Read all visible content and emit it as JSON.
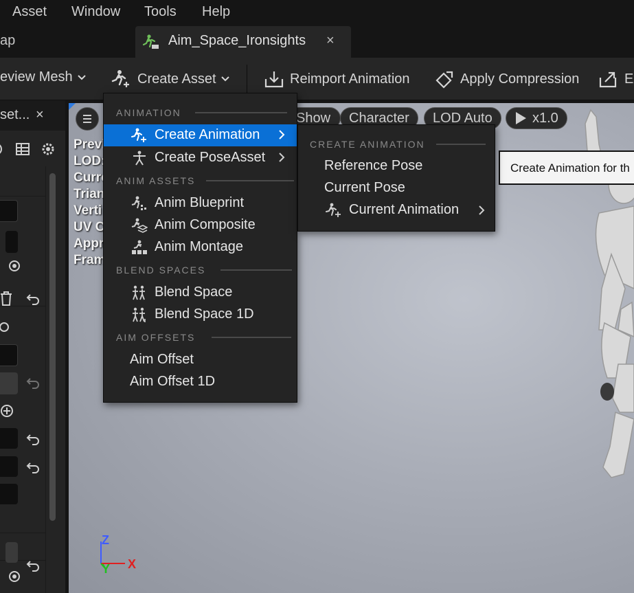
{
  "menubar": {
    "items": [
      "Asset",
      "Window",
      "Tools",
      "Help"
    ]
  },
  "tabs": {
    "previous": "ap",
    "active": "Aim_Space_Ironsights",
    "close": "×"
  },
  "toolbar": {
    "preview_mesh": "eview Mesh",
    "create_asset": "Create Asset",
    "reimport": "Reimport Animation",
    "apply_compression": "Apply Compression",
    "export": "Ex"
  },
  "left_panel": {
    "tab_label": "set...",
    "close": "×"
  },
  "viewport": {
    "pills": [
      "Show",
      "Character",
      "LOD Auto",
      "x1.0"
    ],
    "info_lines": [
      "Previ",
      "LOD:",
      "Curre",
      "Trian",
      "Verti",
      "UV C",
      "Appr",
      "Fram"
    ],
    "axis": {
      "z": "Z",
      "x": "X",
      "y": "Y"
    }
  },
  "tooltip": {
    "text": "Create Animation for th"
  },
  "create_asset_menu": {
    "sections": [
      "ANIMATION",
      "ANIM ASSETS",
      "BLEND SPACES",
      "AIM OFFSETS"
    ],
    "items": [
      {
        "label": "Create Animation",
        "icon": "running-figure-plus-icon",
        "submenu": true,
        "highlighted": true
      },
      {
        "label": "Create PoseAsset",
        "icon": "pose-figure-icon",
        "submenu": true
      },
      {
        "label": "Anim Blueprint",
        "icon": "anim-blueprint-icon"
      },
      {
        "label": "Anim Composite",
        "icon": "anim-composite-icon"
      },
      {
        "label": "Anim Montage",
        "icon": "anim-montage-icon"
      },
      {
        "label": "Blend Space",
        "icon": "blend-space-icon"
      },
      {
        "label": "Blend Space 1D",
        "icon": "blend-space-1d-icon"
      },
      {
        "label": "Aim Offset"
      },
      {
        "label": "Aim Offset 1D"
      }
    ]
  },
  "create_animation_submenu": {
    "section": "CREATE ANIMATION",
    "items": [
      "Reference Pose",
      "Current Pose",
      "Current Animation"
    ]
  },
  "colors": {
    "highlight": "#0a70d6",
    "menu_bg": "#242424",
    "toolbar_bg": "#262626"
  }
}
